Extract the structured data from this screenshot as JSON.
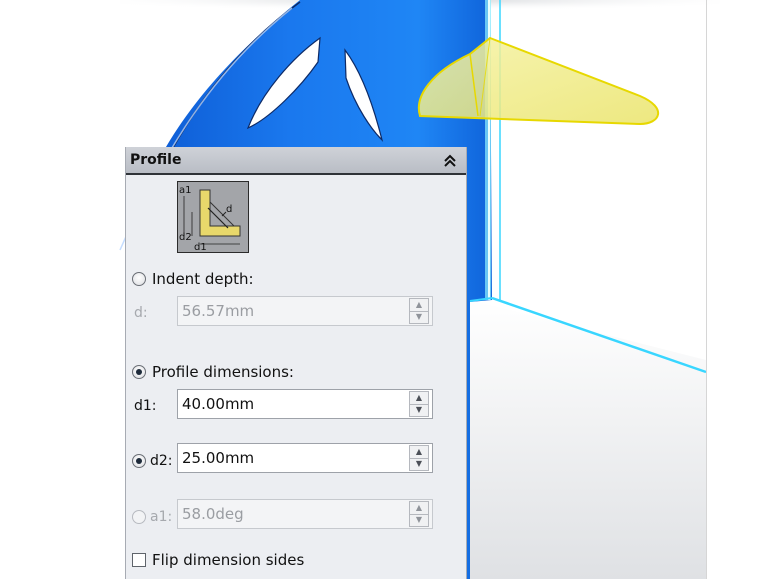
{
  "panel": {
    "title": "Profile",
    "indent_depth": {
      "label": "Indent depth:",
      "checked": false,
      "field_label": "d:",
      "value": "56.57mm",
      "enabled": false
    },
    "profile_dimensions": {
      "label": "Profile dimensions:",
      "checked": true
    },
    "d1": {
      "label": "d1:",
      "value": "40.00mm",
      "enabled": true
    },
    "d2": {
      "label": "d2:",
      "value": "25.00mm",
      "enabled": true,
      "checked": true
    },
    "a1": {
      "label": "a1:",
      "value": "58.0deg",
      "enabled": false,
      "checked": false
    },
    "flip": {
      "label": "Flip dimension sides",
      "checked": false
    },
    "profile_image_labels": {
      "a1": "a1",
      "d": "d",
      "d2": "d2",
      "d1": "d1"
    }
  },
  "colors": {
    "model_blue": "#1a73e8",
    "highlight_yellow": "#f2ee6a",
    "edge_cyan": "#39d6ff"
  },
  "icons": {
    "collapse": "double-chevron-up-icon",
    "spin_up": "triangle-up",
    "spin_down": "triangle-down"
  }
}
